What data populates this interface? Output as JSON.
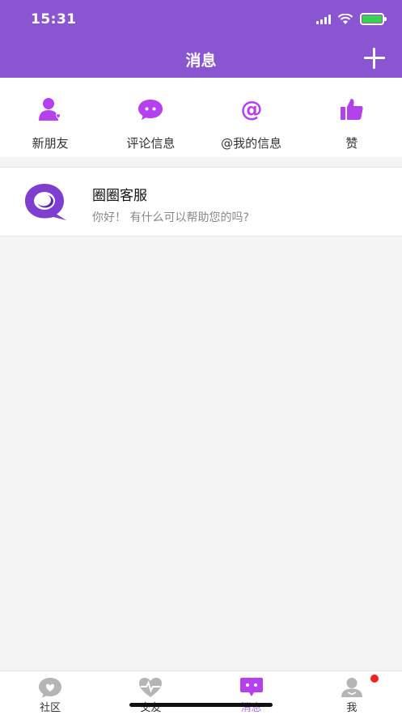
{
  "status_bar": {
    "time": "15:31"
  },
  "header": {
    "title": "消息",
    "add_icon": "plus-icon"
  },
  "quick_actions": [
    {
      "label": "新朋友",
      "icon": "new-friend-icon"
    },
    {
      "label": "评论信息",
      "icon": "comment-icon"
    },
    {
      "label": "@我的信息",
      "icon": "at-icon"
    },
    {
      "label": "赞",
      "icon": "thumbs-up-icon"
    }
  ],
  "messages": [
    {
      "name": "圈圈客服",
      "preview": "你好！ 有什么可以帮助您的吗?",
      "avatar_icon": "chat-bubble-q-icon"
    }
  ],
  "tabbar": {
    "tabs": [
      {
        "label": "社区",
        "icon": "community-icon"
      },
      {
        "label": "交友",
        "icon": "heart-pulse-icon"
      },
      {
        "label": "消息",
        "icon": "message-icon"
      },
      {
        "label": "我",
        "icon": "profile-icon"
      }
    ],
    "active_tab": "消息",
    "badge_tab": "我"
  },
  "colors": {
    "header_bg": "#8a55d1",
    "accent": "#b06de3",
    "icon_purple": "#b540ee",
    "tab_gray": "#b5b5b5",
    "badge_red": "#f0241f"
  }
}
